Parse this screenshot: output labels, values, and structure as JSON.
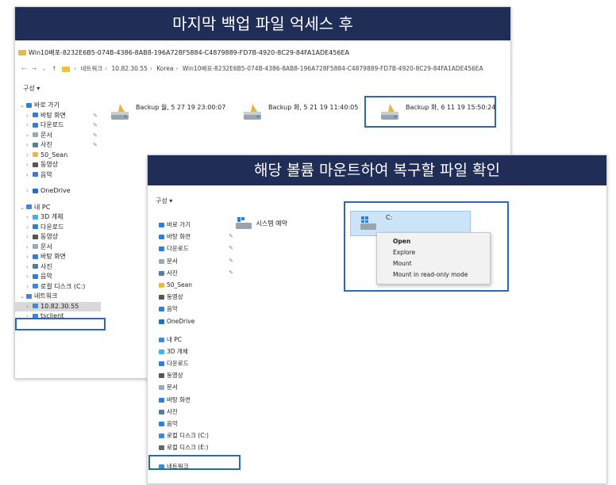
{
  "window1": {
    "banner": "마지막 백업 파일 억세스 후",
    "title": "Win10배포-8232E6B5-074B-4386-8AB8-196A728F5884-C4879889-FD7B-4920-8C29-84FA1ADE456EA",
    "address": {
      "crumbs": [
        "네트워크",
        "10.82.30.55",
        "Korea",
        "Win10배포-8232E6B5-074B-4386-8AB8-196A728F5884-C4879889-FD7B-4920-8C29-84FA1ADE456EA"
      ]
    },
    "toolbar_label": "구성 ▾",
    "nav": [
      {
        "label": "바로 가기",
        "type": "header",
        "icon": "star-icon",
        "color": "#2f7fd8"
      },
      {
        "label": "바탕 화면",
        "icon": "desktop-icon",
        "color": "#2f7fd8",
        "pin": true
      },
      {
        "label": "다운로드",
        "icon": "download-icon",
        "color": "#2f7fd8",
        "pin": true
      },
      {
        "label": "문서",
        "icon": "document-icon",
        "color": "#9aa7b8",
        "pin": true
      },
      {
        "label": "사진",
        "icon": "pictures-icon",
        "color": "#5a7a9a",
        "pin": true
      },
      {
        "label": "50_Sean",
        "icon": "folder-icon",
        "color": "#e8b84a"
      },
      {
        "label": "동영상",
        "icon": "videos-icon",
        "color": "#555"
      },
      {
        "label": "음악",
        "icon": "music-icon",
        "color": "#2f7fd8"
      },
      {
        "label": "",
        "type": "spacer"
      },
      {
        "label": "OneDrive",
        "icon": "onedrive-icon",
        "color": "#1e6fd0"
      },
      {
        "label": "",
        "type": "spacer"
      },
      {
        "label": "내 PC",
        "type": "header",
        "icon": "pc-icon",
        "color": "#3a8ad8"
      },
      {
        "label": "3D 개체",
        "icon": "3d-objects-icon",
        "color": "#3cb4e6"
      },
      {
        "label": "다운로드",
        "icon": "download-icon",
        "color": "#2f7fd8"
      },
      {
        "label": "동영상",
        "icon": "videos-icon",
        "color": "#555"
      },
      {
        "label": "문서",
        "icon": "document-icon",
        "color": "#9aa7b8"
      },
      {
        "label": "바탕 화면",
        "icon": "desktop-icon",
        "color": "#2f7fd8"
      },
      {
        "label": "사진",
        "icon": "pictures-icon",
        "color": "#5a7a9a"
      },
      {
        "label": "음악",
        "icon": "music-icon",
        "color": "#2f7fd8"
      },
      {
        "label": "로컬 디스크 (C:)",
        "icon": "drive-icon",
        "color": "#3a8ad8"
      },
      {
        "label": "네트워크",
        "type": "header",
        "icon": "network-icon",
        "color": "#3a8ad8"
      },
      {
        "label": "10.82.30.55",
        "icon": "server-icon",
        "color": "#3a8ad8",
        "selected": true
      },
      {
        "label": "tsclient",
        "icon": "server-icon",
        "color": "#3a8ad8"
      }
    ],
    "backups": [
      {
        "label": "Backup 월, 5 27 19 23:00:07"
      },
      {
        "label": "Backup 화, 5 21 19 11:40:05"
      },
      {
        "label": "Backup 화, 6 11 19 15:50:24"
      }
    ]
  },
  "window2": {
    "banner": "해당 볼륨 마운트하여 복구할 파일 확인",
    "toolbar_label": "구성 ▾",
    "nav": [
      {
        "label": "바로 가기",
        "icon": "star-icon",
        "color": "#2f7fd8"
      },
      {
        "label": "바탕 화면",
        "icon": "desktop-icon",
        "color": "#2f7fd8",
        "pin": true
      },
      {
        "label": "다운로드",
        "icon": "download-icon",
        "color": "#2f7fd8",
        "pin": true
      },
      {
        "label": "문서",
        "icon": "document-icon",
        "color": "#9aa7b8",
        "pin": true
      },
      {
        "label": "사진",
        "icon": "pictures-icon",
        "color": "#5a7a9a",
        "pin": true
      },
      {
        "label": "50_Sean",
        "icon": "folder-icon",
        "color": "#e8b84a"
      },
      {
        "label": "동영상",
        "icon": "videos-icon",
        "color": "#555"
      },
      {
        "label": "음악",
        "icon": "music-icon",
        "color": "#2f7fd8"
      },
      {
        "label": "OneDrive",
        "icon": "onedrive-icon",
        "color": "#1e6fd0"
      },
      {
        "label": "",
        "type": "spacer"
      },
      {
        "label": "내 PC",
        "icon": "pc-icon",
        "color": "#3a8ad8"
      },
      {
        "label": "3D 개체",
        "icon": "3d-objects-icon",
        "color": "#3cb4e6"
      },
      {
        "label": "다운로드",
        "icon": "download-icon",
        "color": "#2f7fd8"
      },
      {
        "label": "동영상",
        "icon": "videos-icon",
        "color": "#555"
      },
      {
        "label": "문서",
        "icon": "document-icon",
        "color": "#9aa7b8"
      },
      {
        "label": "바탕 화면",
        "icon": "desktop-icon",
        "color": "#2f7fd8"
      },
      {
        "label": "사진",
        "icon": "pictures-icon",
        "color": "#5a7a9a"
      },
      {
        "label": "음악",
        "icon": "music-icon",
        "color": "#2f7fd8"
      },
      {
        "label": "로컬 디스크 (C:)",
        "icon": "drive-icon",
        "color": "#3a8ad8"
      },
      {
        "label": "로컬 디스크 (E:)",
        "icon": "drive-icon",
        "color": "#666"
      },
      {
        "label": "",
        "type": "spacer"
      },
      {
        "label": "네트워크",
        "icon": "network-icon",
        "color": "#3a8ad8"
      }
    ],
    "system_reserved": "시스템 예약",
    "drive_c": "C:",
    "context_menu": [
      "Open",
      "Explore",
      "Mount",
      "Mount in read-only mode"
    ]
  },
  "colors": {
    "banner": "#1f2d57",
    "highlight": "#2c67b8",
    "selection": "#cce4f7"
  }
}
